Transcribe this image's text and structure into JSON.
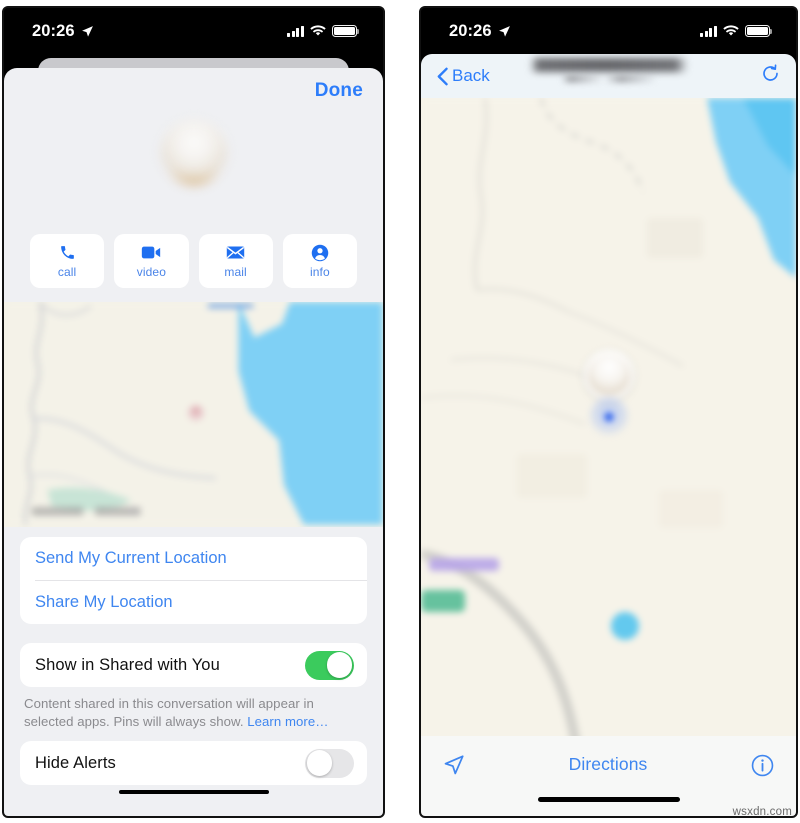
{
  "meta": {
    "watermark": "wsxdn.com"
  },
  "status_bar": {
    "time": "20:26",
    "location_icon": "location-arrow-icon",
    "signal_icon": "cellular-bars-icon",
    "wifi_icon": "wifi-icon",
    "battery_icon": "battery-full-icon"
  },
  "left_screen": {
    "name": "contact-details-sheet",
    "done_label": "Done",
    "contact_name": "",
    "avatar_icon": "contact-avatar-image",
    "actions": [
      {
        "label": "call",
        "icon": "phone-icon"
      },
      {
        "label": "video",
        "icon": "video-camera-icon"
      },
      {
        "label": "mail",
        "icon": "envelope-icon"
      },
      {
        "label": "info",
        "icon": "person-circle-icon"
      }
    ],
    "map_preview": {
      "name": "location-map-preview",
      "attribution": ""
    },
    "location_rows": [
      {
        "label": "Send My Current Location"
      },
      {
        "label": "Share My Location"
      }
    ],
    "shared_with_you": {
      "label": "Show in Shared with You",
      "enabled": true
    },
    "footnote": {
      "text": "Content shared in this conversation will appear in selected apps. Pins will always show. ",
      "link": "Learn more…"
    },
    "hide_alerts": {
      "label": "Hide Alerts",
      "enabled": false
    }
  },
  "right_screen": {
    "name": "map-detail-screen",
    "nav": {
      "back_label": "Back",
      "back_icon": "chevron-left-icon",
      "title": "",
      "subtitle": "",
      "refresh_icon": "refresh-icon"
    },
    "map": {
      "name": "contact-location-map",
      "pin_icon": "contact-pin-avatar",
      "user_dot_icon": "user-location-dot"
    },
    "bottom_bar": {
      "navigate_icon": "navigate-arrow-icon",
      "directions_label": "Directions",
      "info_icon": "info-circle-icon"
    }
  },
  "colors": {
    "accent_blue": "#3f86f0",
    "done_blue": "#2d7dfa",
    "toggle_green": "#3bcb5d",
    "toggle_off_gray": "#e6e6e8",
    "sheet_bg": "#eff0f3",
    "map_land": "#f6f3e9",
    "map_water": "#7fd0f5",
    "map_park": "#4cb891",
    "map_road": "#c9c9cc"
  }
}
